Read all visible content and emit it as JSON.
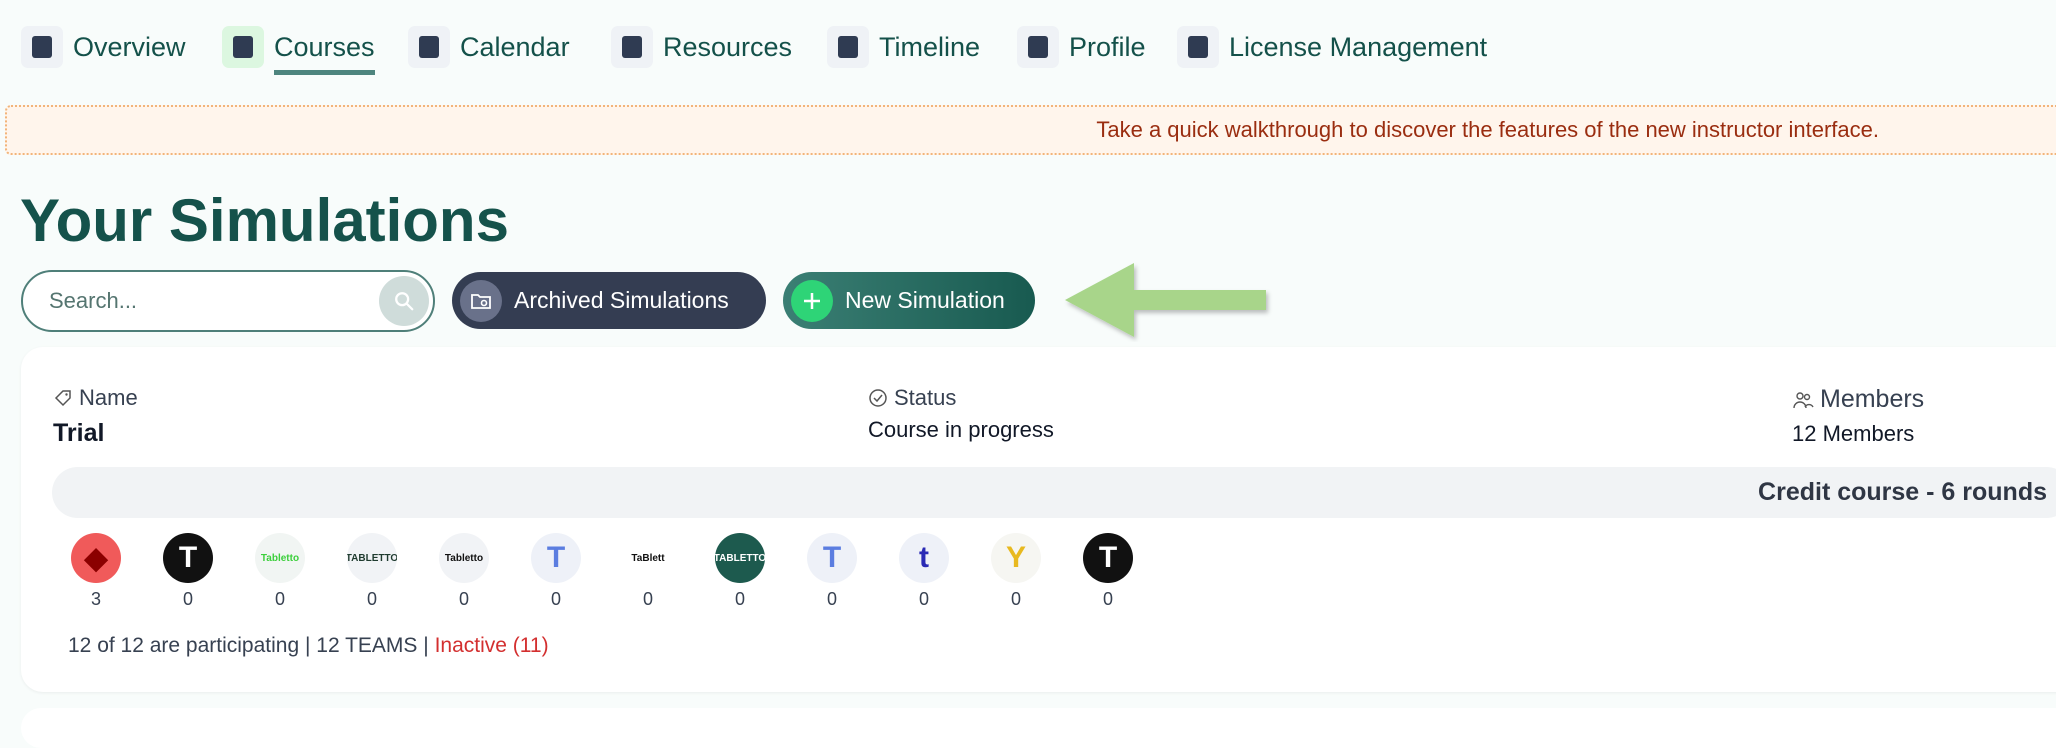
{
  "nav": [
    {
      "label": "Overview",
      "icon": "dashboard-add-icon"
    },
    {
      "label": "Courses",
      "icon": "clipboard-list-icon",
      "active": true
    },
    {
      "label": "Calendar",
      "icon": "calendar-icon"
    },
    {
      "label": "Resources",
      "icon": "documents-icon"
    },
    {
      "label": "Timeline",
      "icon": "timeline-icon"
    },
    {
      "label": "Profile",
      "icon": "user-gear-icon"
    },
    {
      "label": "License Management",
      "icon": "key-icon"
    }
  ],
  "banner": "Take a quick walkthrough to discover the features of the new instructor interface.",
  "title": "Your Simulations",
  "search": {
    "placeholder": "Search..."
  },
  "buttons": {
    "archived": "Archived Simulations",
    "new": "New Simulation"
  },
  "colors": {
    "brand": "#15524b",
    "accent_arrow": "#a8d58a",
    "inactive": "#d32f2f"
  },
  "simulation": {
    "name_label": "Name",
    "name": "Trial",
    "status_label": "Status",
    "status": "Course in progress",
    "members_label": "Members",
    "members": "12 Members",
    "course_type": "Credit course - 6 rounds",
    "teams": [
      {
        "count": "3",
        "bg": "#f05a5a",
        "fg": "#8b0000",
        "glyph": "◆"
      },
      {
        "count": "0",
        "bg": "#111111",
        "fg": "#ffffff",
        "glyph": "T"
      },
      {
        "count": "0",
        "bg": "#f1f5f3",
        "fg": "#3ccf3c",
        "glyph": "Tabletto"
      },
      {
        "count": "0",
        "bg": "#f1f3f6",
        "fg": "#1f3b2f",
        "glyph": "TABLETTO"
      },
      {
        "count": "0",
        "bg": "#f1f3f6",
        "fg": "#111111",
        "glyph": "Tabletto"
      },
      {
        "count": "0",
        "bg": "#eef1f8",
        "fg": "#5b7de0",
        "glyph": "T"
      },
      {
        "count": "0",
        "bg": "#ffffff",
        "fg": "#111111",
        "glyph": "TaBlett"
      },
      {
        "count": "0",
        "bg": "#1d5a4e",
        "fg": "#ffffff",
        "glyph": "TABLETTO"
      },
      {
        "count": "0",
        "bg": "#eef1f8",
        "fg": "#5b7de0",
        "glyph": "T"
      },
      {
        "count": "0",
        "bg": "#eef1f8",
        "fg": "#2a2ab5",
        "glyph": "t"
      },
      {
        "count": "0",
        "bg": "#f6f6f2",
        "fg": "#e8b920",
        "glyph": "Y"
      },
      {
        "count": "0",
        "bg": "#111111",
        "fg": "#ffffff",
        "glyph": "T"
      }
    ],
    "participation": "12 of 12 are participating | 12 TEAMS |",
    "inactive": "Inactive (11)"
  }
}
